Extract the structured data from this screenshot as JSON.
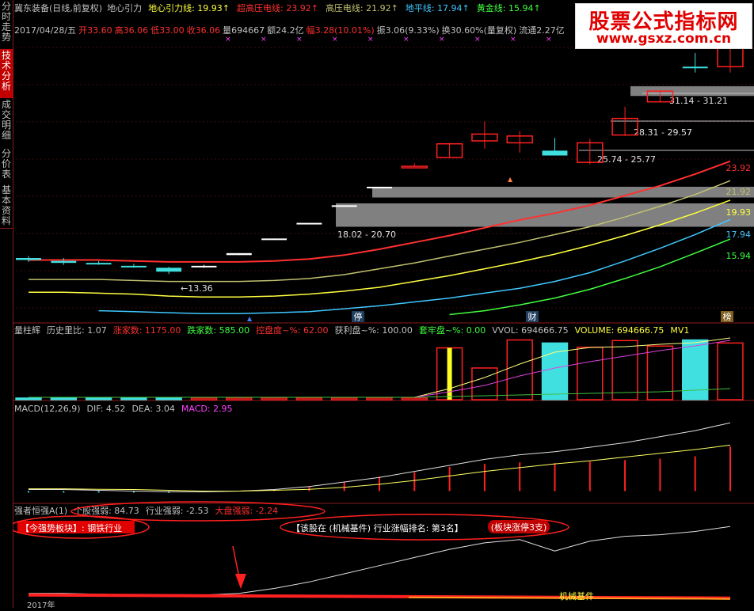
{
  "sidebar": [
    {
      "label": "分时走势",
      "active": false
    },
    {
      "label": "技术分析",
      "active": true
    },
    {
      "label": "成交明细",
      "active": false
    },
    {
      "label": "分价表",
      "active": false
    },
    {
      "label": "基本资料",
      "active": false
    }
  ],
  "watermark": {
    "title": "股票公式指标网",
    "url": "www.gsxz.com.cn"
  },
  "header": {
    "stock": "冀东装备(日线,前复权)",
    "indicator": "地心引力",
    "lines": [
      {
        "label": "地心引力线:",
        "value": "19.93",
        "color": "#ffff40"
      },
      {
        "label": "超高压电线:",
        "value": "23.92",
        "color": "#ff3030"
      },
      {
        "label": "高压电线:",
        "value": "21.92",
        "color": "#c0c070"
      },
      {
        "label": "地平线:",
        "value": "17.94",
        "color": "#40c8ff"
      },
      {
        "label": "黄金线:",
        "value": "15.94",
        "color": "#40ff40"
      }
    ],
    "ohlc": [
      {
        "label": "2017/04/28/五",
        "color": "#c0c0c0"
      },
      {
        "label": "开33.60",
        "color": "#ff3030"
      },
      {
        "label": "高36.06",
        "color": "#ff3030"
      },
      {
        "label": "低33.00",
        "color": "#ff3030"
      },
      {
        "label": "收36.06",
        "color": "#ff3030"
      },
      {
        "label": "量694667",
        "color": "#c0c0c0"
      },
      {
        "label": "额24.2亿",
        "color": "#c0c0c0"
      },
      {
        "label": "幅3.28(10.01%)",
        "color": "#ff3030"
      },
      {
        "label": "振3.06(9.33%)",
        "color": "#c0c0c0"
      },
      {
        "label": "换30.60%(量复权)",
        "color": "#c0c0c0"
      },
      {
        "label": "流通2.27亿",
        "color": "#c0c0c0"
      }
    ]
  },
  "main_annotations": {
    "zones": [
      "31.14 - 31.21",
      "28.31 - 29.57",
      "25.74 - 25.77",
      "18.02 - 20.70"
    ],
    "low_label": "←13.36",
    "right_values": [
      {
        "value": "23.92",
        "color": "#ff3030"
      },
      {
        "value": "21.92",
        "color": "#c0c070"
      },
      {
        "value": "19.93",
        "color": "#ffff40"
      },
      {
        "value": "17.94",
        "color": "#40c8ff"
      },
      {
        "value": "15.94",
        "color": "#40ff40"
      }
    ],
    "badges": [
      "停",
      "财",
      "榜"
    ]
  },
  "vol_header": {
    "items": [
      {
        "text": "量柱辉",
        "color": "#c0c0c0"
      },
      {
        "text": "历史里比: 1.07",
        "color": "#c0c0c0"
      },
      {
        "text": "涨家数: 1175.00",
        "color": "#ff3030"
      },
      {
        "text": "跌家数: 585.00",
        "color": "#40ff40"
      },
      {
        "text": "控盘度~%: 62.00",
        "color": "#ff3030"
      },
      {
        "text": "获利盘~%: 100.00",
        "color": "#c0c0c0"
      },
      {
        "text": "套牢盘~%: 0.00",
        "color": "#40ff40"
      },
      {
        "text": "VVOL: 694666.75",
        "color": "#c0c0c0"
      },
      {
        "text": "VOLUME: 694666.75",
        "color": "#ffff40"
      },
      {
        "text": "MV1",
        "color": "#ffff40"
      }
    ]
  },
  "macd_header": {
    "items": [
      {
        "text": "MACD(12,26,9)",
        "color": "#c0c0c0"
      },
      {
        "text": "DIF: 4.52",
        "color": "#c0c0c0"
      },
      {
        "text": "DEA: 3.04",
        "color": "#c0c0c0"
      },
      {
        "text": "MACD: 2.95",
        "color": "#ff40ff"
      }
    ]
  },
  "strength_header": {
    "items": [
      {
        "text": "强者恒强A(1)",
        "color": "#c0c0c0"
      },
      {
        "text": "个股强弱: 84.73",
        "color": "#c0c0c0"
      },
      {
        "text": "行业强弱: -2.53",
        "color": "#c0c0c0"
      },
      {
        "text": "大盘强弱: -2.24",
        "color": "#ff3030"
      }
    ],
    "sector_tag": "【今强势板块】: 钢铁行业",
    "rank_text": "【该股在 (机械基件) 行业涨幅排名: 第3名】",
    "limit_tag": "(板块涨停3支)",
    "industry_label": "机械基件",
    "footer_date": "2017年"
  },
  "chart_data": [
    {
      "type": "candlestick",
      "title": "冀东装备(日线,前复权)",
      "candles": [
        {
          "o": 14.0,
          "h": 14.2,
          "l": 13.6,
          "c": 13.8,
          "up": false
        },
        {
          "o": 13.7,
          "h": 14.0,
          "l": 13.3,
          "c": 13.5,
          "up": false
        },
        {
          "o": 13.5,
          "h": 13.7,
          "l": 13.3,
          "c": 13.45,
          "up": false
        },
        {
          "o": 13.2,
          "h": 13.4,
          "l": 13.0,
          "c": 13.1,
          "up": false
        },
        {
          "o": 13.0,
          "h": 13.1,
          "l": 12.36,
          "c": 12.6,
          "up": false
        },
        {
          "o": 13.2,
          "h": 13.3,
          "l": 13.0,
          "c": 13.2,
          "up": true
        },
        {
          "o": 14.3,
          "h": 14.5,
          "l": 14.3,
          "c": 14.5,
          "up": true
        },
        {
          "o": 15.9,
          "h": 16.0,
          "l": 15.9,
          "c": 16.0,
          "up": true
        },
        {
          "o": 17.6,
          "h": 17.6,
          "l": 17.6,
          "c": 17.6,
          "up": true
        },
        {
          "o": 19.4,
          "h": 19.4,
          "l": 19.4,
          "c": 19.4,
          "up": true
        },
        {
          "o": 21.3,
          "h": 21.3,
          "l": 21.3,
          "c": 21.3,
          "up": true
        },
        {
          "o": 23.4,
          "h": 23.7,
          "l": 23.4,
          "c": 23.4,
          "up": true
        },
        {
          "o": 24.3,
          "h": 25.8,
          "l": 24.3,
          "c": 25.7,
          "up": true
        },
        {
          "o": 26.0,
          "h": 28.0,
          "l": 25.2,
          "c": 26.7,
          "up": true
        },
        {
          "o": 25.8,
          "h": 27.0,
          "l": 24.8,
          "c": 26.5,
          "up": true
        },
        {
          "o": 25.0,
          "h": 26.3,
          "l": 24.8,
          "c": 24.5,
          "up": false
        },
        {
          "o": 23.8,
          "h": 26.2,
          "l": 23.6,
          "c": 25.8,
          "up": true
        },
        {
          "o": 26.6,
          "h": 29.5,
          "l": 26.5,
          "c": 28.3,
          "up": true
        },
        {
          "o": 30.0,
          "h": 31.2,
          "l": 30.0,
          "c": 31.1,
          "up": true
        },
        {
          "o": 33.6,
          "h": 35.0,
          "l": 33.0,
          "c": 33.6,
          "up": false
        },
        {
          "o": 33.6,
          "h": 36.06,
          "l": 33.0,
          "c": 36.06,
          "up": true
        }
      ],
      "lines": [
        {
          "name": "超高压电线",
          "color": "#ff3030",
          "values": [
            13.8,
            13.8,
            13.8,
            13.7,
            13.6,
            13.6,
            13.6,
            13.7,
            13.9,
            14.3,
            14.9,
            15.6,
            16.3,
            17.1,
            17.9,
            18.6,
            19.4,
            20.4,
            21.4,
            22.6,
            23.92
          ]
        },
        {
          "name": "高压电线",
          "color": "#c0c070",
          "values": [
            11.8,
            11.8,
            11.8,
            11.7,
            11.6,
            11.6,
            11.6,
            11.7,
            11.9,
            12.3,
            12.9,
            13.5,
            14.2,
            14.9,
            15.6,
            16.4,
            17.2,
            18.2,
            19.3,
            20.5,
            21.92
          ]
        },
        {
          "name": "地心引力线",
          "color": "#ffff40",
          "values": [
            10.5,
            10.5,
            10.4,
            10.3,
            10.1,
            10.0,
            10.0,
            10.1,
            10.3,
            10.6,
            11.0,
            11.6,
            12.2,
            12.9,
            13.6,
            14.4,
            15.3,
            16.3,
            17.4,
            18.6,
            19.93
          ]
        },
        {
          "name": "地平线",
          "color": "#40c8ff",
          "values": [
            null,
            null,
            8.6,
            8.5,
            8.4,
            8.3,
            8.3,
            8.4,
            8.5,
            8.8,
            9.1,
            9.5,
            9.9,
            10.4,
            10.9,
            11.6,
            12.5,
            13.7,
            15.0,
            16.4,
            17.94
          ]
        },
        {
          "name": "黄金线",
          "color": "#40ff40",
          "values": [
            null,
            null,
            null,
            null,
            null,
            null,
            null,
            null,
            null,
            null,
            null,
            null,
            8.2,
            8.6,
            9.2,
            9.9,
            10.8,
            11.9,
            13.1,
            14.5,
            15.94
          ]
        }
      ],
      "ylim": [
        8,
        38
      ]
    },
    {
      "type": "bar",
      "title": "量柱辉",
      "values": [
        0.02,
        0.03,
        0.02,
        0.02,
        0.02,
        0.02,
        0.01,
        0.01,
        0.005,
        0.005,
        0.01,
        0.02,
        0.85,
        0.52,
        0.98,
        0.93,
        0.86,
        0.97,
        0.88,
        0.98,
        0.93
      ],
      "ylim": [
        0,
        1
      ]
    },
    {
      "type": "bar",
      "title": "MACD(12,26,9)",
      "values": [
        -0.1,
        -0.1,
        -0.1,
        -0.1,
        -0.12,
        -0.05,
        0.0,
        0.1,
        0.3,
        0.6,
        0.95,
        1.25,
        1.6,
        1.8,
        1.9,
        1.85,
        1.95,
        2.05,
        2.15,
        2.3,
        2.95
      ],
      "ylim": [
        -0.5,
        5
      ]
    },
    {
      "type": "line",
      "title": "强者恒强A(1)",
      "values": [
        0.0,
        0.0,
        -0.05,
        -0.1,
        -0.2,
        -0.1,
        0.0,
        0.3,
        0.7,
        1.2,
        1.7,
        2.2,
        2.7,
        3.1,
        3.3,
        2.6,
        3.2,
        3.5,
        3.6,
        3.8,
        4.1
      ],
      "ylim": [
        -0.5,
        4.6
      ]
    }
  ]
}
